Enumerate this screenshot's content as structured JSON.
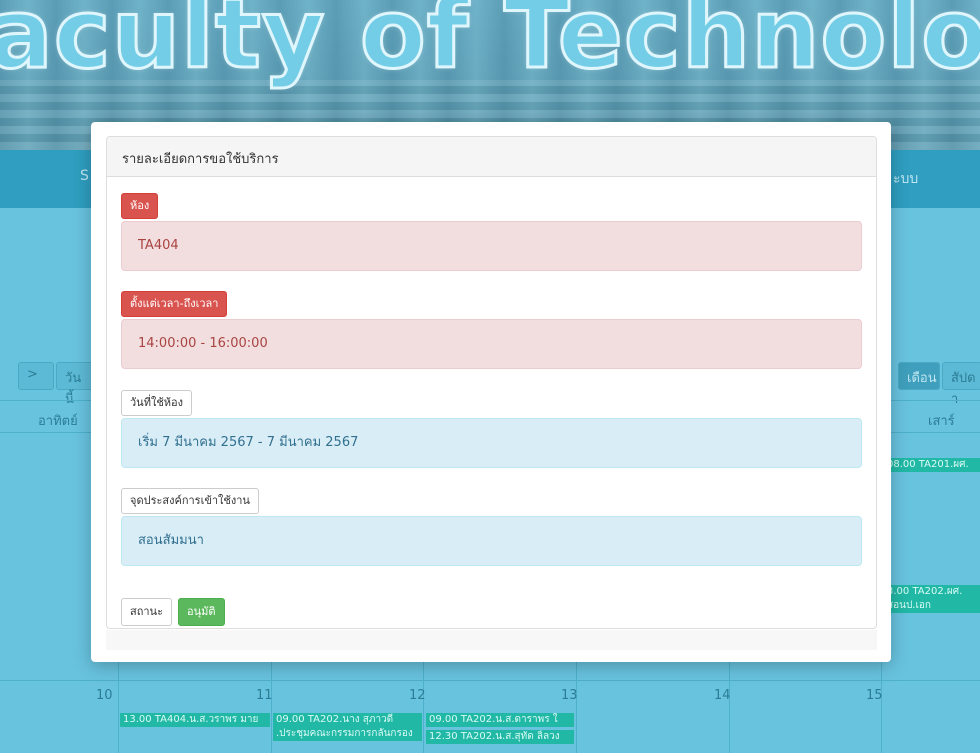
{
  "banner": {
    "title": "aculty of Technology"
  },
  "navbar": {
    "left_fragment": "S",
    "right_fragment": "ะบบ"
  },
  "calendar": {
    "next_button": ">",
    "today_button": "วันนี้",
    "view_month": "เดือน",
    "view_week": "สัปดา",
    "day_sunday": "อาทิตย์",
    "day_saturday": "เสาร์",
    "day_numbers": [
      "10",
      "11",
      "12",
      "13",
      "14",
      "15"
    ],
    "events": [
      "08.00 TA201.ผศ.",
      "3.00 TA202.ผศ.",
      "สอนป.เอก",
      "13.00 TA404.น.ส.วราพร มาย",
      "09.00 TA202.นาง สุภาวดี",
      ".ประชุมคณะกรรมการกลั่นกรอง",
      "09.00 TA202.น.ส.ดาราพร ใ",
      "12.30 TA202.น.ส.สุทัด ลิ้ลวง"
    ]
  },
  "modal": {
    "heading": "รายละเอียดการขอใช้บริการ",
    "room_label": "ห้อง",
    "room_value": "TA404",
    "time_label": "ตั้งแต่เวลา-ถึงเวลา",
    "time_value": "14:00:00 - 16:00:00",
    "date_label": "วันที่ใช้ห้อง",
    "date_value": "เริ่ม 7 มีนาคม 2567 - 7 มีนาคม 2567",
    "purpose_label": "จุดประสงค์การเข้าใช้งาน",
    "purpose_value": "สอนสัมมนา",
    "status_label": "สถานะ",
    "status_value": "อนุมัติ"
  },
  "colors": {
    "danger": "#d9534f",
    "danger_bg": "#f2dede",
    "info_bg": "#d9edf7",
    "success": "#5cb85c",
    "page_bg": "#68bfd9"
  }
}
